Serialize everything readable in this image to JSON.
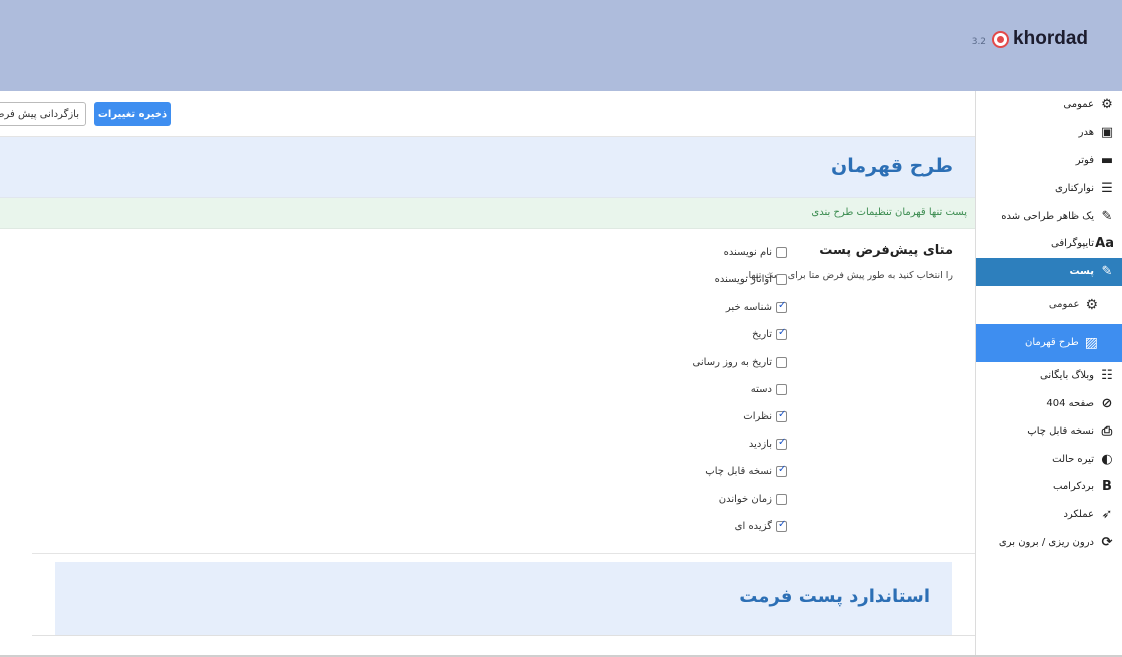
{
  "brand": {
    "name": "khordad",
    "version": "3.2"
  },
  "sidebar": {
    "items": [
      {
        "label": "عمومی",
        "icon": "gear-icon",
        "glyph": "⚙"
      },
      {
        "label": "هدر",
        "icon": "header-icon",
        "glyph": "▣"
      },
      {
        "label": "فوتر",
        "icon": "footer-icon",
        "glyph": "▬"
      },
      {
        "label": "نوارکناری",
        "icon": "sidebar-lines-icon",
        "glyph": "☰"
      },
      {
        "label": "یک ظاهر طراحی شده",
        "icon": "brush-icon",
        "glyph": "✎"
      },
      {
        "label": "تایپوگرافی",
        "icon": "typography-icon",
        "glyph": "Aa"
      },
      {
        "label": "پست",
        "icon": "pencil-icon",
        "glyph": "✎"
      }
    ],
    "sub": [
      {
        "label": "عمومی",
        "icon": "gear-icon",
        "glyph": "⚙"
      },
      {
        "label": "طرح قهرمان",
        "icon": "image-icon",
        "glyph": "▨"
      }
    ],
    "more": [
      {
        "label": "وبلاگ بایگانی",
        "icon": "list-icon",
        "glyph": "☷"
      },
      {
        "label": "صفحه 404",
        "icon": "ban-icon",
        "glyph": "⊘"
      },
      {
        "label": "نسخه قابل چاپ",
        "icon": "print-icon",
        "glyph": "⎙"
      },
      {
        "label": "تیره حالت",
        "icon": "dark-mode-icon",
        "glyph": "◐"
      },
      {
        "label": "بردکرامب",
        "icon": "bold-icon",
        "glyph": "B"
      },
      {
        "label": "عملکرد",
        "icon": "rocket-icon",
        "glyph": "➶"
      },
      {
        "label": "درون ریزی / برون بری",
        "icon": "refresh-icon",
        "glyph": "⟳"
      }
    ]
  },
  "toolbar": {
    "save_label": "ذخیره تغییرات",
    "reset_label": "بازگردانی پیش فرض"
  },
  "section": {
    "title": "طرح قهرمان",
    "notice": "پست تنها قهرمان تنظیمات طرح بندی"
  },
  "setting": {
    "title": "متای پیش‌فرض پست",
    "desc": "را انتخاب کنید به طور پیش فرض متا برای پست تنها.",
    "options": [
      {
        "label": "نام نویسنده",
        "checked": false
      },
      {
        "label": "آواتار نویسنده",
        "checked": false
      },
      {
        "label": "شناسه خبر",
        "checked": true
      },
      {
        "label": "تاریخ",
        "checked": true
      },
      {
        "label": "تاریخ به روز رسانی",
        "checked": false
      },
      {
        "label": "دسته",
        "checked": false
      },
      {
        "label": "نظرات",
        "checked": true
      },
      {
        "label": "بازدید",
        "checked": true
      },
      {
        "label": "نسخه قابل چاپ",
        "checked": true
      },
      {
        "label": "زمان خواندن",
        "checked": false
      },
      {
        "label": "گزیده ای",
        "checked": true
      }
    ]
  },
  "section2": {
    "title": "استاندارد پست فرمت"
  },
  "colors": {
    "header": "#aebcdc",
    "accent": "#3e8ef0",
    "active": "#2d7fbd",
    "notice": "#3a8b4f"
  }
}
